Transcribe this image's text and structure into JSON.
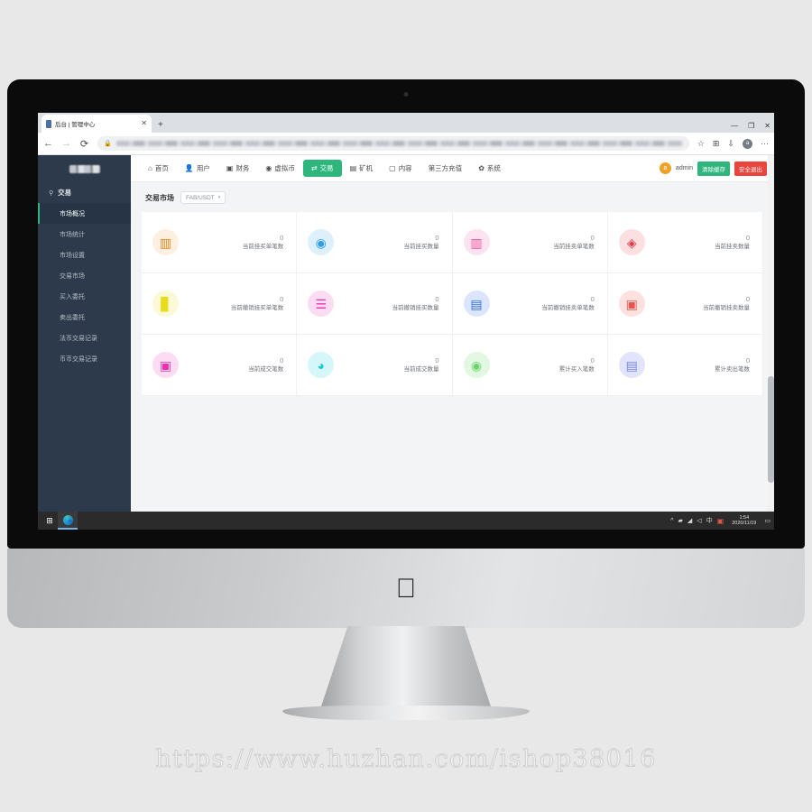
{
  "browser": {
    "tab_title": "后台 | 管理中心",
    "tab_close": "✕",
    "new_tab": "+",
    "win_minimize": "—",
    "win_maximize": "❐",
    "win_close": "✕",
    "back_icon": "←",
    "forward_icon": "→",
    "reload_icon": "⟳",
    "lock_icon": "🔒",
    "favorite_icon": "☆",
    "collections_icon": "⊞",
    "downloads_icon": "⇩",
    "profile_icon": "a",
    "more_icon": "···"
  },
  "sidebar": {
    "search_icon": "search-icon",
    "section_title": "交易",
    "items": [
      {
        "label": "市场概况",
        "active": true
      },
      {
        "label": "市场统计",
        "active": false
      },
      {
        "label": "市场设置",
        "active": false
      },
      {
        "label": "交易市场",
        "active": false
      },
      {
        "label": "买入委托",
        "active": false
      },
      {
        "label": "卖出委托",
        "active": false
      },
      {
        "label": "法币交易记录",
        "active": false
      },
      {
        "label": "币币交易记录",
        "active": false
      }
    ]
  },
  "topnav": {
    "items": [
      {
        "label": "首页",
        "icon": "⌂",
        "active": false
      },
      {
        "label": "用户",
        "icon": "👤",
        "active": false
      },
      {
        "label": "财务",
        "icon": "▣",
        "active": false
      },
      {
        "label": "虚拟币",
        "icon": "◉",
        "active": false
      },
      {
        "label": "交易",
        "icon": "⇄",
        "active": true
      },
      {
        "label": "矿机",
        "icon": "▤",
        "active": false
      },
      {
        "label": "内容",
        "icon": "▢",
        "active": false
      },
      {
        "label": "第三方充值",
        "icon": "",
        "active": false
      },
      {
        "label": "系统",
        "icon": "✿",
        "active": false
      }
    ],
    "user_initial": "a",
    "user_name": "admin",
    "clear_cache_label": "清除缓存",
    "logout_label": "安全退出",
    "accent_green": "#2fb67c",
    "accent_red": "#e8453c"
  },
  "page": {
    "title": "交易市场",
    "market_value": "FAB/USDT",
    "caret_icon": "▾",
    "cards": [
      {
        "value": "0",
        "label": "当前挂买单笔数",
        "icon": "▥",
        "fg": "#f08519",
        "bg": "#fdf0e0"
      },
      {
        "value": "0",
        "label": "当前挂买数量",
        "icon": "◉",
        "fg": "#2f9fe8",
        "bg": "#ddf0fc"
      },
      {
        "value": "0",
        "label": "当前挂卖单笔数",
        "icon": "▥",
        "fg": "#e8509b",
        "bg": "#fde3f0"
      },
      {
        "value": "0",
        "label": "当前挂卖数量",
        "icon": "◈",
        "fg": "#e63b46",
        "bg": "#fce0e1"
      },
      {
        "value": "0",
        "label": "当前撤销挂买单笔数",
        "icon": "▊",
        "fg": "#e8dc1e",
        "bg": "#fbf9d6"
      },
      {
        "value": "0",
        "label": "当前撤销挂买数量",
        "icon": "☰",
        "fg": "#ef2fae",
        "bg": "#fcdcf2"
      },
      {
        "value": "0",
        "label": "当前撤销挂卖单笔数",
        "icon": "▤",
        "fg": "#2f6fe8",
        "bg": "#dbe6fc"
      },
      {
        "value": "0",
        "label": "当前撤销挂卖数量",
        "icon": "▣",
        "fg": "#e8554c",
        "bg": "#fce1df"
      },
      {
        "value": "0",
        "label": "当前成交笔数",
        "icon": "▣",
        "fg": "#ef2fae",
        "bg": "#fcdcf2"
      },
      {
        "value": "0",
        "label": "当前成交数量",
        "icon": "◕",
        "fg": "#17ccd6",
        "bg": "#d6f7f9"
      },
      {
        "value": "0",
        "label": "累计买入笔数",
        "icon": "◉",
        "fg": "#6fd36f",
        "bg": "#e2f8e2"
      },
      {
        "value": "0",
        "label": "累计卖出笔数",
        "icon": "▤",
        "fg": "#7a85e8",
        "bg": "#e2e4fb"
      }
    ]
  },
  "taskbar": {
    "start_icon": "⊞",
    "edge_icon": "edge-icon",
    "chevron_icon": "^",
    "folder_icon": "▰",
    "wifi_icon": "◢",
    "volume_icon": "◁",
    "ime_label": "中",
    "app_icon": "▣",
    "clock_time": "1:54",
    "clock_date": "2020/11/19",
    "notify_icon": "▭"
  },
  "watermark": {
    "text": "https://www.huzhan.com/ishop38016"
  }
}
